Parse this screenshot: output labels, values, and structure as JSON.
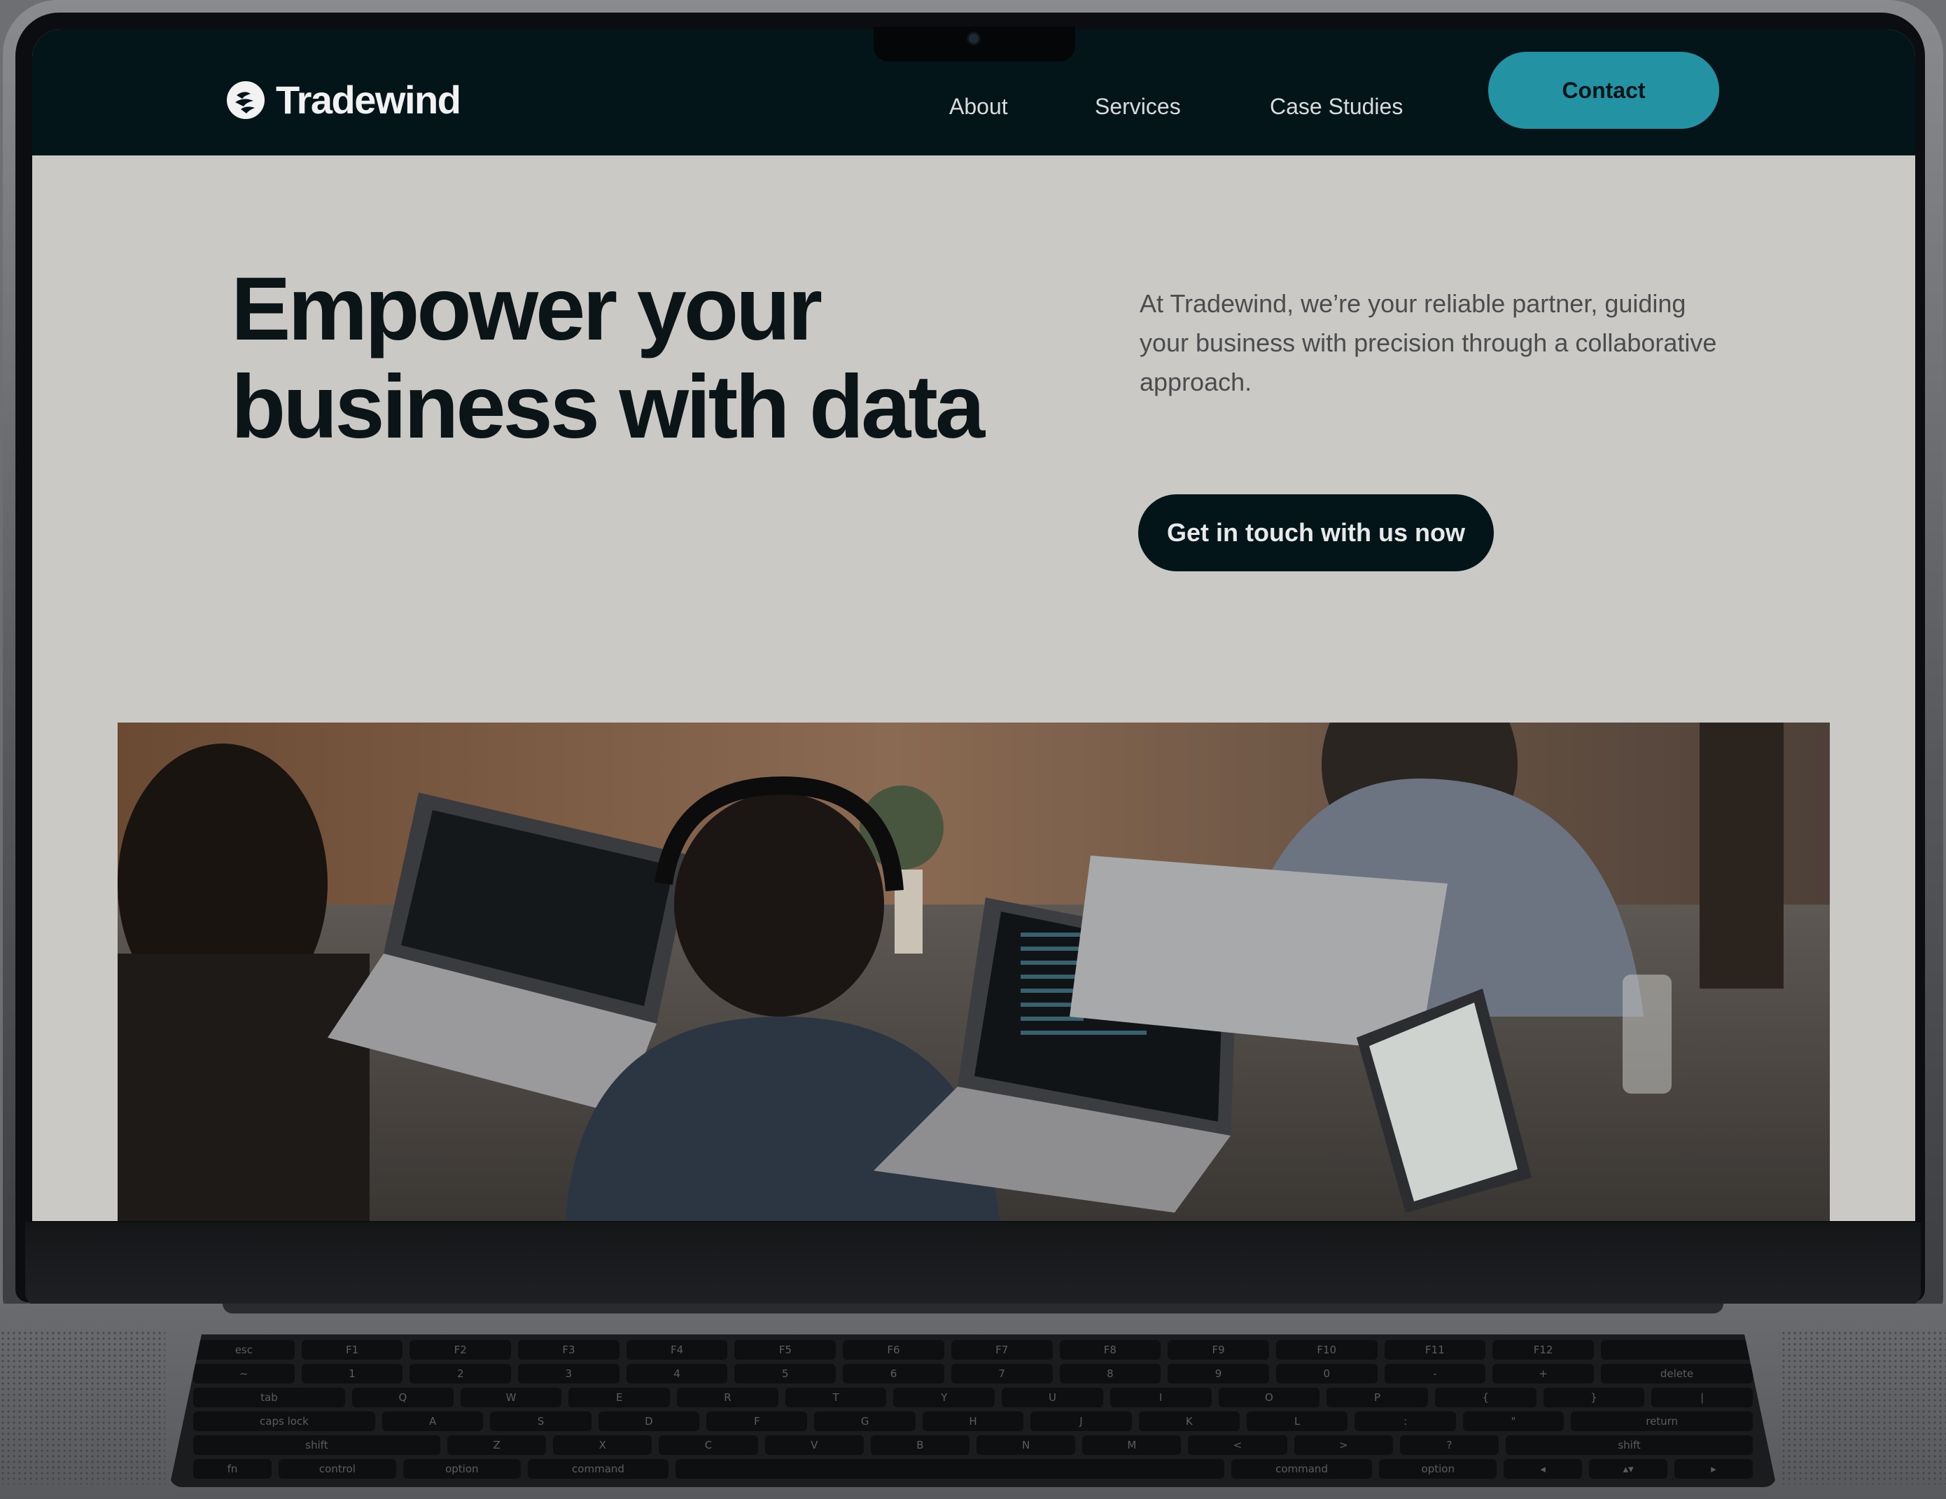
{
  "site": {
    "brand": "Tradewind",
    "nav": [
      {
        "label": "About"
      },
      {
        "label": "Services"
      },
      {
        "label": "Case Studies"
      }
    ],
    "contact_label": "Contact"
  },
  "hero": {
    "title_line1": "Empower your",
    "title_line2": "business with data",
    "description": "At Tradewind, we’re your reliable partner, guiding your business with precision through a collaborative approach.",
    "cta_label": "Get in touch with us now"
  },
  "colors": {
    "nav_bg": "#04151a",
    "accent": "#2393a3",
    "page_bg": "#cbc9c5",
    "text_dark": "#0b1416"
  },
  "keyboard": {
    "rows": [
      [
        "esc",
        "F1",
        "F2",
        "F3",
        "F4",
        "F5",
        "F6",
        "F7",
        "F8",
        "F9",
        "F10",
        "F11",
        "F12",
        ""
      ],
      [
        "~",
        "1",
        "2",
        "3",
        "4",
        "5",
        "6",
        "7",
        "8",
        "9",
        "0",
        "-",
        "+",
        "delete"
      ],
      [
        "tab",
        "Q",
        "W",
        "E",
        "R",
        "T",
        "Y",
        "U",
        "I",
        "O",
        "P",
        "{",
        "}",
        "|"
      ],
      [
        "caps lock",
        "A",
        "S",
        "D",
        "F",
        "G",
        "H",
        "J",
        "K",
        "L",
        ":",
        "\"",
        "return"
      ],
      [
        "shift",
        "Z",
        "X",
        "C",
        "V",
        "B",
        "N",
        "M",
        "<",
        ">",
        "?",
        "shift"
      ],
      [
        "fn",
        "control",
        "option",
        "command",
        "",
        "command",
        "option",
        "◂",
        "▴▾",
        "▸"
      ]
    ]
  }
}
